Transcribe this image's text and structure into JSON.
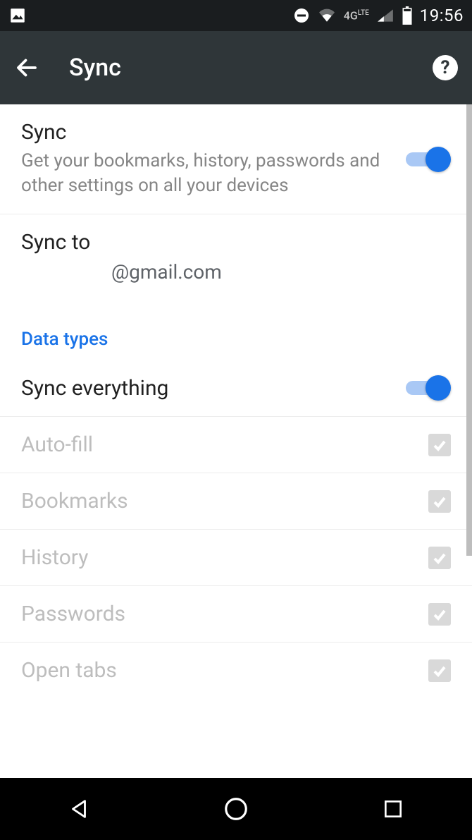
{
  "statusbar": {
    "network_label": "4G",
    "network_suffix": "LTE",
    "clock": "19:56"
  },
  "appbar": {
    "title": "Sync"
  },
  "sync_main": {
    "title": "Sync",
    "subtitle": "Get your bookmarks, history, passwords and other settings on all your devices",
    "enabled": true
  },
  "sync_to": {
    "label": "Sync to",
    "email": "@gmail.com"
  },
  "section_header": "Data types",
  "sync_everything": {
    "label": "Sync everything",
    "enabled": true
  },
  "items": [
    {
      "label": "Auto-fill",
      "checked": true
    },
    {
      "label": "Bookmarks",
      "checked": true
    },
    {
      "label": "History",
      "checked": true
    },
    {
      "label": "Passwords",
      "checked": true
    },
    {
      "label": "Open tabs",
      "checked": true
    }
  ]
}
